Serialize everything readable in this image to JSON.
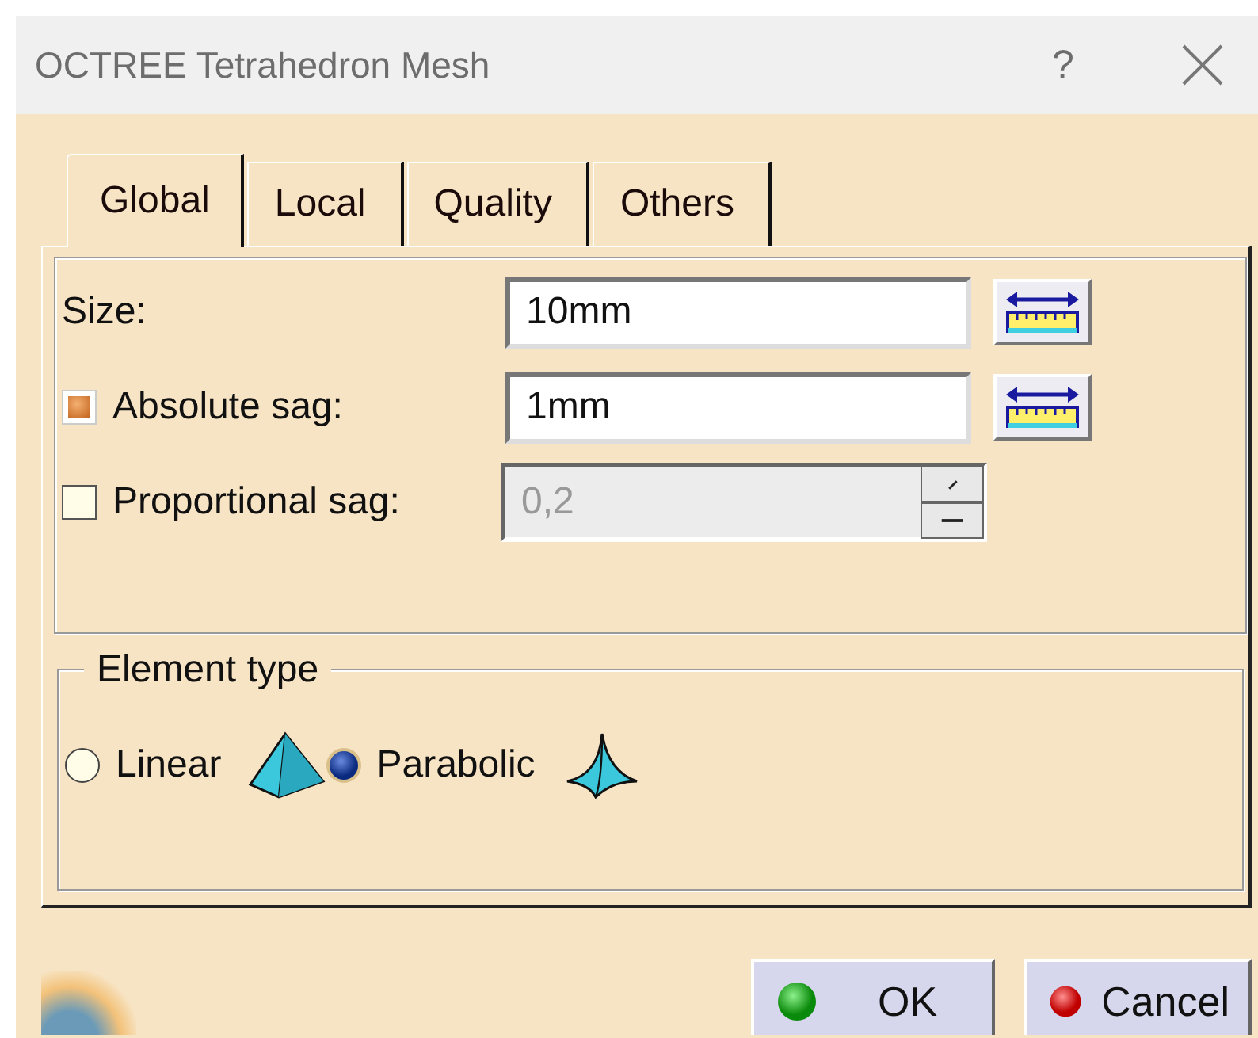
{
  "window": {
    "title": "OCTREE Tetrahedron Mesh",
    "help": "?"
  },
  "tabs": [
    {
      "label": "Global",
      "selected": true
    },
    {
      "label": "Local",
      "selected": false
    },
    {
      "label": "Quality",
      "selected": false
    },
    {
      "label": "Others",
      "selected": false
    }
  ],
  "parameters": [
    {
      "kind": "measure",
      "label": "Size:",
      "value": "10mm"
    },
    {
      "kind": "measure",
      "label": "Absolute sag:",
      "checked": true,
      "value": "1mm"
    },
    {
      "kind": "spinner",
      "label": "Proportional sag:",
      "checked": false,
      "value": "0,2",
      "disabled": true
    }
  ],
  "element_type": {
    "title": "Element type",
    "options": [
      {
        "label": "Linear",
        "selected": false
      },
      {
        "label": "Parabolic",
        "selected": true
      }
    ]
  },
  "buttons": [
    {
      "kind": "ok",
      "label": "OK"
    },
    {
      "kind": "cancel",
      "label": "Cancel"
    }
  ]
}
